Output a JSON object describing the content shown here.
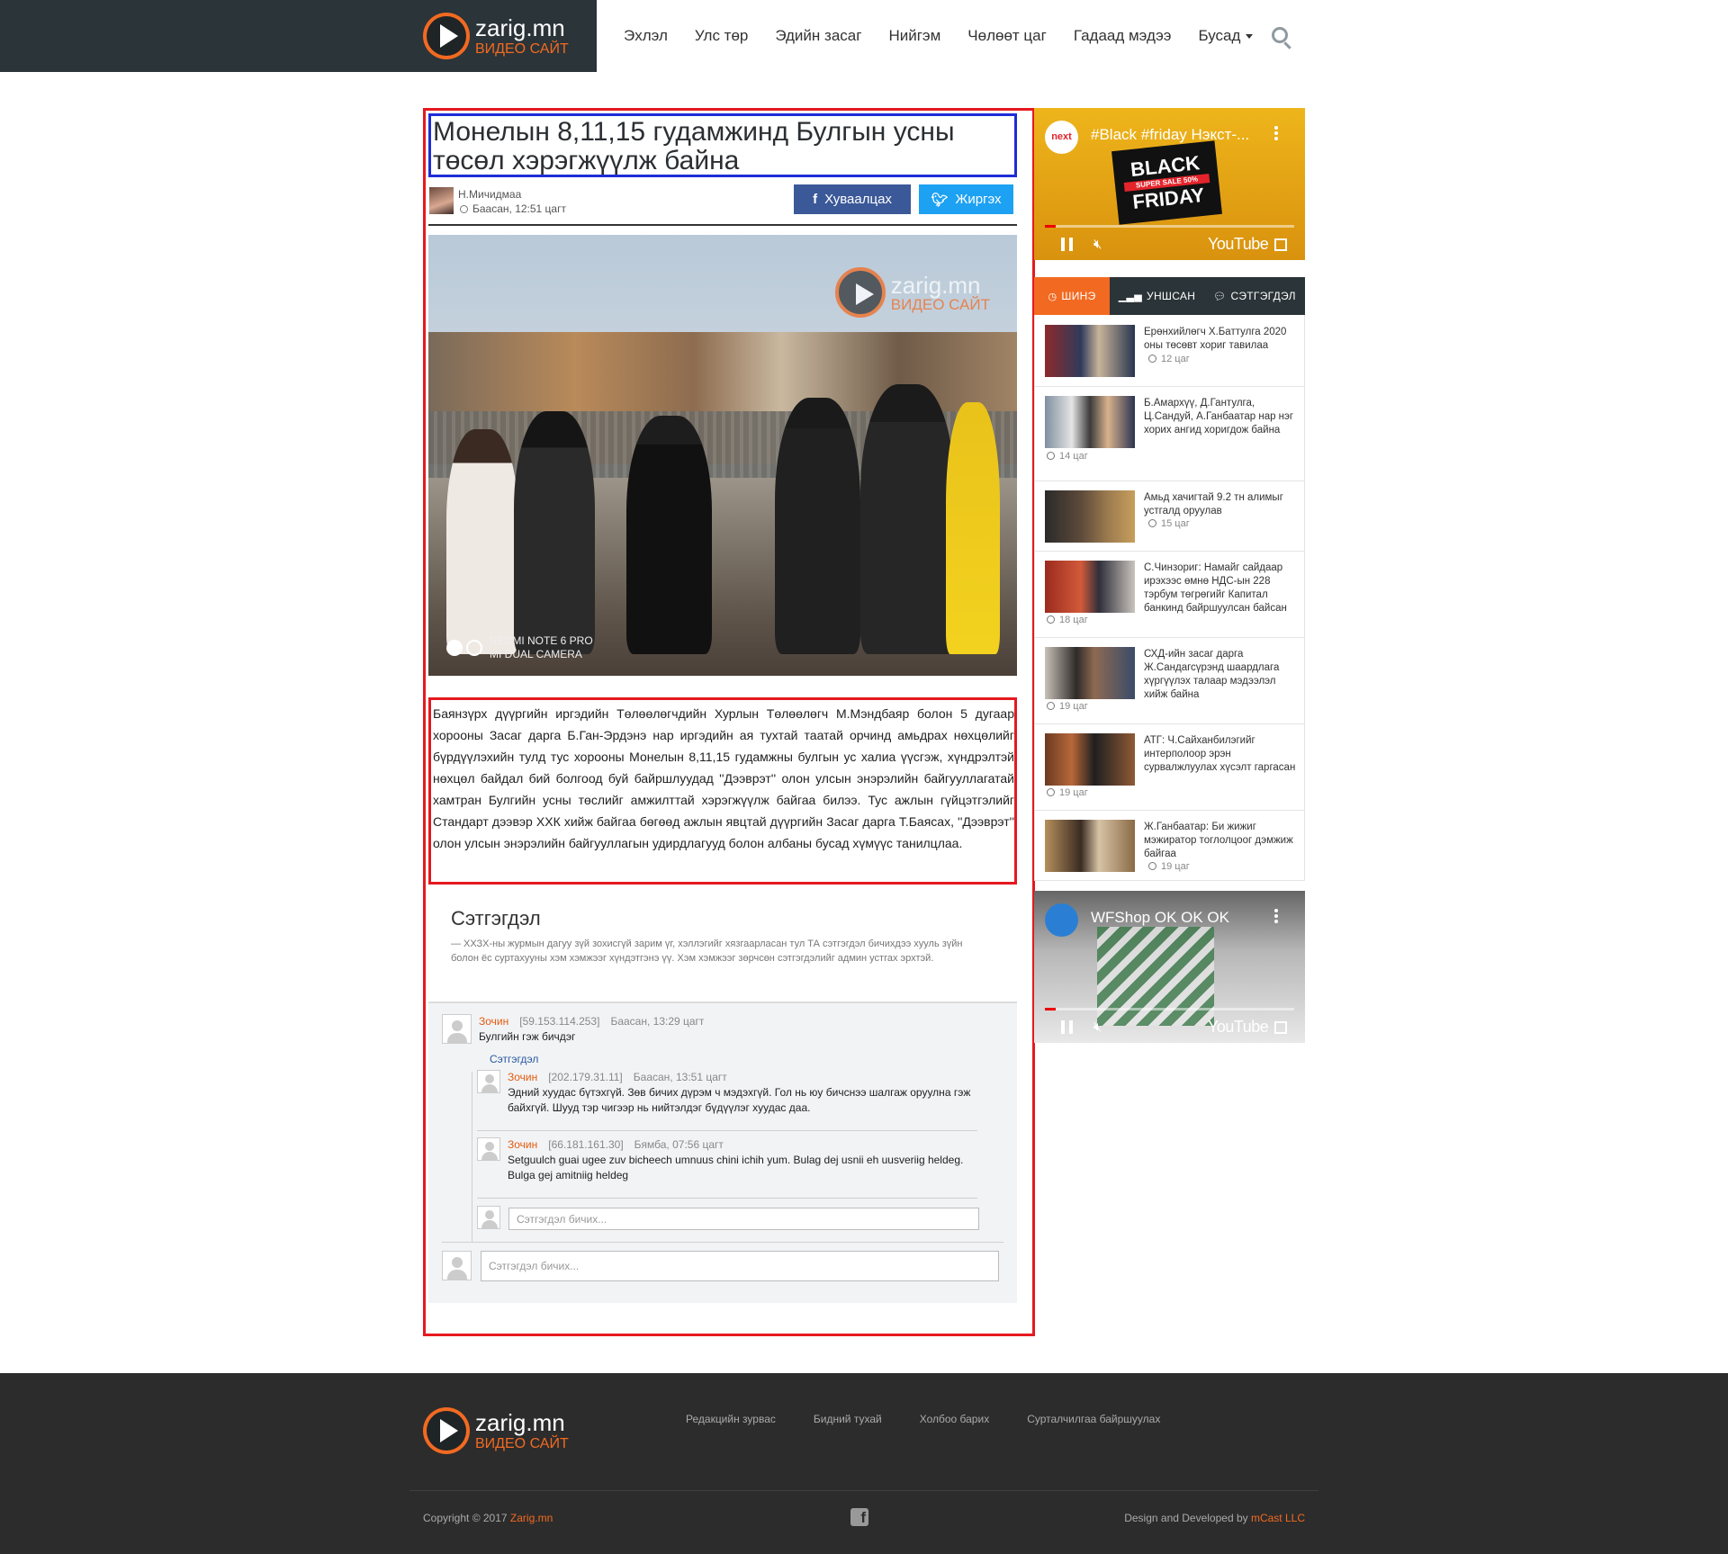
{
  "header": {
    "logo_name": "zarig.mn",
    "logo_sub": "ВИДЕО САЙТ",
    "nav": [
      "Эхлэл",
      "Улс төр",
      "Эдийн засаг",
      "Нийгэм",
      "Чөлөөт цаг",
      "Гадаад мэдээ",
      "Бусад"
    ],
    "search_icon": "search-icon"
  },
  "article": {
    "title": "Монелын 8,11,15 гудамжинд Булгын усны төсөл хэрэгжүүлж байна",
    "author": "Н.Мичидмаа",
    "time": "Баасан, 12:51 цагт",
    "share_facebook": "Хуваалцах",
    "share_twitter": "Жиргэх",
    "photo_watermark": "zarig.mn",
    "photo_watermark_sub": "ВИДЕО САЙТ",
    "photo_camera_1": "REDMI NOTE 6 PRO",
    "photo_camera_2": "MI DUAL CAMERA",
    "body": "Баянзүрх дүүргийн иргэдийн Төлөөлөгчдийн Хурлын Төлөөлөгч М.Мэндбаяр болон 5 дугаар хорооны Засаг дарга Б.Ган-Эрдэнэ нар иргэдийн ая тухтай таатай орчинд амьдрах нөхцөлийг бүрдүүлэхийн тулд тус хорооны Монелын 8,11,15 гудамжны булгын ус халиа үүсгэж, хүндрэлтэй нөхцөл байдал бий болгоод буй байршлуудад ''Дээврэт'' олон улсын энэрэлийн байгууллагатай хамтран Булгийн усны төслийг амжилттай хэрэгжүүлж байгаа билээ. Тус ажлын гүйцэтгэлийг Стандарт дээвэр ХХК хийж байгаа бөгөөд ажлын явцтай дүүргийн Засаг дарга Т.Баясах, ''Дээврэт'' олон улсын энэрэлийн байгууллагын удирдлагууд болон албаны бусад хүмүүс танилцлаа."
  },
  "comments": {
    "heading": "Сэтгэгдэл",
    "rules": "— ХХЗХ-ны журмын дагуу зүй зохисгүй зарим үг, хэллэгийг хязгаарласан тул ТА сэтгэгдэл бичихдээ хууль зүйн болон ёс суртахууны хэм хэмжээг хүндэтгэнэ үү. Хэм хэмжээг зөрчсөн сэтгэгдэлийг админ устгах эрхтэй.",
    "reply_label": "Сэтгэгдэл",
    "placeholder": "Сэтгэгдэл бичих...",
    "items": [
      {
        "author": "Зочин",
        "ip": "[59.153.114.253]",
        "time": "Баасан, 13:29 цагт",
        "text": "Булгийн гэж бичдэг"
      },
      {
        "author": "Зочин",
        "ip": "[202.179.31.11]",
        "time": "Баасан, 13:51 цагт",
        "text": "Эдний хуудас бүтэхгүй. Зөв бичих дүрэм ч мэдэхгүй. Гол нь юу бичснээ шалгаж оруулна гэж байхгүй. Шууд тэр чигээр нь нийтэлдэг бүдүүлэг хуудас даа."
      },
      {
        "author": "Зочин",
        "ip": "[66.181.161.30]",
        "time": "Бямба, 07:56 цагт",
        "text": "Setguulch guai ugee zuv bicheech umnuus chini ichih yum. Bulag dej usnii eh uusveriig heldeg. Bulga gej amitniig heldeg"
      }
    ]
  },
  "sidebar": {
    "video1": {
      "title": "#Black #friday Нэкст-...",
      "channel": "next",
      "promo_1": "BLACK",
      "promo_2": "FRIDAY",
      "promo_sale": "SUPER SALE 50%",
      "player_logo": "YouTube"
    },
    "video2": {
      "title": "WFShop OK OK OK",
      "player_logo": "YouTube"
    },
    "tabs": [
      "ШИНЭ",
      "УНШСАН",
      "СЭТГЭГДЭЛ"
    ],
    "news": [
      {
        "title": "Ерөнхийлөгч Х.Баттулга 2020 оны төсөвт хориг тавилаа",
        "time": "12 цаг"
      },
      {
        "title": "Б.Амархүү, Д.Гантулга, Ц.Сандуй, А.Ганбаатар нар нэг хорих ангид хоригдож байна",
        "time": "14 цаг"
      },
      {
        "title": "Амьд хачигтай 9.2 тн алимыг устгалд оруулав",
        "time": "15 цаг"
      },
      {
        "title": "С.Чинзориг: Намайг сайдаар ирэхээс өмнө НДС-ын 228 тэрбум төгрөгийг Капитал банкинд байршуулсан байсан",
        "time": "18 цаг"
      },
      {
        "title": "СХД-ийн засаг дарга Ж.Сандагсүрэнд шаардлага хүргүүлэх талаар мэдээлэл хийж байна",
        "time": "19 цаг"
      },
      {
        "title": "АТГ: Ч.Сайханбилэгийг интерполоор эрэн сурвалжлуулах хүсэлт гаргасан",
        "time": "19 цаг"
      },
      {
        "title": "Ж.Ганбаатар: Би жижиг мэжиратор тоглолцоог дэмжиж байгаа",
        "time": "19 цаг"
      }
    ]
  },
  "footer": {
    "links": [
      "Редакцийн зурвас",
      "Бидний тухай",
      "Холбоо барих",
      "Сурталчилгаа байршуулах"
    ],
    "copy_prefix": "Copyright © 2017 ",
    "copy_site": "Zarig.mn",
    "dev_prefix": "Design and Developed by ",
    "dev_name": "mCast LLC"
  },
  "colors": {
    "accent": "#f26a21",
    "header_dark": "#2b3438",
    "highlight_red": "#e5191f",
    "highlight_blue": "#1e2dd6",
    "facebook": "#3b5998",
    "twitter": "#1da1f2"
  }
}
